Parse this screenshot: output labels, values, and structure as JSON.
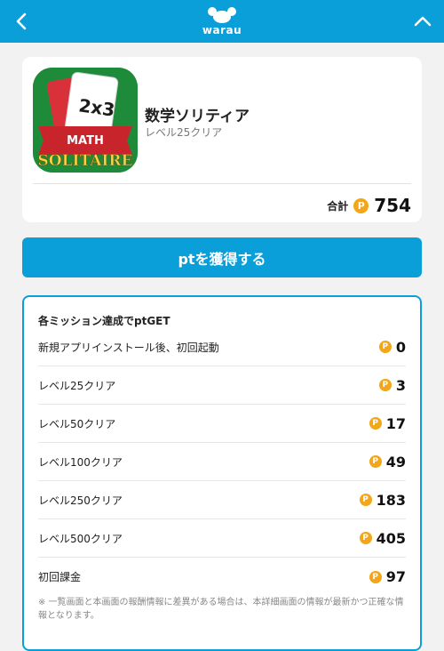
{
  "header": {
    "logo_text": "warau",
    "back_icon": "chevron-left-icon",
    "collapse_icon": "chevron-up-icon",
    "color": "#0a9fd8"
  },
  "app": {
    "name": "数学ソリティア",
    "subtitle": "レベル25クリア",
    "icon_text_top": "2x3",
    "icon_text_mid": "MATH",
    "icon_text_bottom": "SOLITAIRE",
    "total_label": "合計",
    "total_points": "754"
  },
  "coin_symbol": "P",
  "cta": {
    "label": "ptを獲得する"
  },
  "missions": {
    "title": "各ミッション達成でptGET",
    "items": [
      {
        "label": "新規アプリインストール後、初回起動",
        "points": "0"
      },
      {
        "label": "レベル25クリア",
        "points": "3"
      },
      {
        "label": "レベル50クリア",
        "points": "17"
      },
      {
        "label": "レベル100クリア",
        "points": "49"
      },
      {
        "label": "レベル250クリア",
        "points": "183"
      },
      {
        "label": "レベル500クリア",
        "points": "405"
      },
      {
        "label": "初回課金",
        "points": "97"
      }
    ],
    "note": "※ 一覧画面と本画面の報酬情報に差異がある場合は、本詳細画面の情報が最新かつ正確な情報となります。"
  },
  "colors": {
    "accent": "#0a9fd8",
    "coin": "#f2a619",
    "icon_bg": "#1e8b3b",
    "ribbon": "#c8242c"
  }
}
